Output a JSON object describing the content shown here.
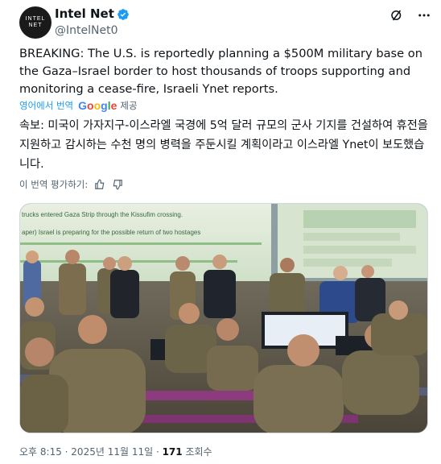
{
  "account": {
    "avatar_line1": "INTEL",
    "avatar_line2": "NET",
    "display_name": "Intel Net",
    "handle": "@IntelNet0"
  },
  "tweet": {
    "text": "BREAKING: The U.S. is reportedly planning a $500M military base on the Gaza–Israel border to host thousands of troops supporting and monitoring a cease-fire, Israeli Ynet reports.",
    "translated_from_label": "영어에서 번역",
    "translation_provider": "Google",
    "translation_provided_label": "제공",
    "translation": "속보: 미국이 가자지구-이스라엘 국경에 5억 달러 규모의 군사 기지를 건설하여 휴전을 지원하고 감시하는 수천 명의 병력을 주둔시킬 계획이라고 이스라엘 Ynet이 보도했습니다.",
    "rate_translation_label": "이 번역 평가하기:",
    "image_caption_line1": "trucks entered Gaza Strip through the Kissufim crossing.",
    "image_caption_line2": "aper) Israel is preparing for the possible return of two hostages",
    "time": "오후 8:15",
    "date": "2025년 11월 11일",
    "views": "171",
    "views_label": "조회수"
  },
  "icons": {
    "verified": "verified-badge-icon",
    "grok": "grok-icon",
    "more": "more-icon",
    "thumbs_up": "thumbs-up-icon",
    "thumbs_down": "thumbs-down-icon"
  },
  "colors": {
    "accent": "#1d9bf0",
    "text": "#0f1419",
    "secondary": "#536471"
  }
}
